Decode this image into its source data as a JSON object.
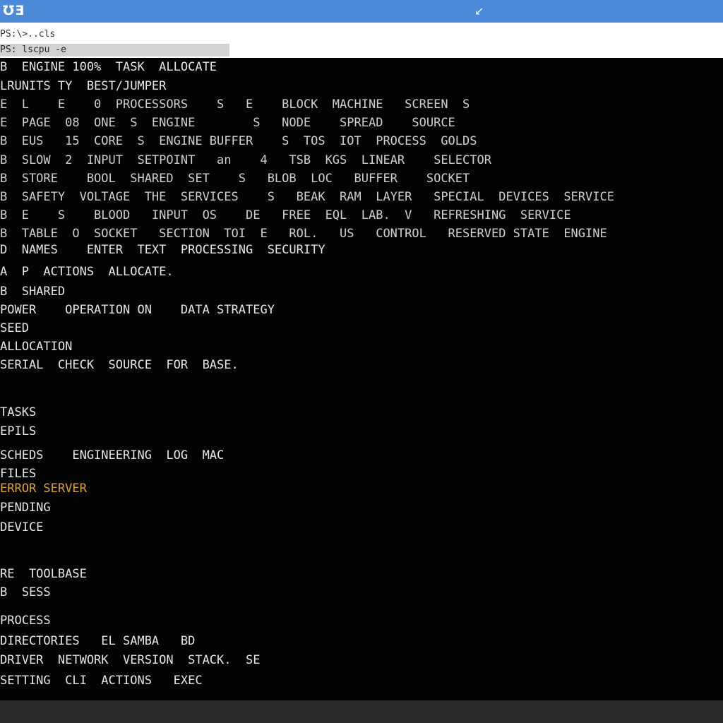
{
  "titlebar": {
    "app_icon": "ƱƎ",
    "control_glyph": "↙"
  },
  "toolbar": {
    "line1": "PS:\\>..cls",
    "line2": "PS: lscpu -e"
  },
  "colors": {
    "titlebar_bg": "#4a8ad8",
    "console_bg": "#030303",
    "text_primary": "#e6e6e6",
    "text_dim": "#b9b9b9",
    "accent_green": "#7fbf3f",
    "accent_orange": "#e0a030"
  },
  "console_lines": [
    {
      "text": "B  ENGINE 100%  TASK  ALLOCATE",
      "color": "#e6e6e6"
    },
    {
      "text": "LRUNITS TY  BEST/JUMPER",
      "color": "#e6e6e6"
    },
    {
      "text": "E  L    E    0  PROCESSORS    S   E    BLOCK  MACHINE   SCREEN  S",
      "color": "#cfcfcf"
    },
    {
      "text": "E  PAGE  08  ONE  S  ENGINE        S   NODE    SPREAD    SOURCE",
      "color": "#cfcfcf"
    },
    {
      "text": "B  EUS   15  CORE  S  ENGINE BUFFER    S  TOS  IOT  PROCESS  GOLDS",
      "color": "#cfcfcf"
    },
    {
      "text": "B  SLOW  2  INPUT  SETPOINT   an    4   TSB  KGS  LINEAR    SELECTOR",
      "color": "#cfcfcf"
    },
    {
      "text": "B  STORE    BOOL  SHARED  SET    S   BLOB  LOC   BUFFER    SOCKET",
      "color": "#cfcfcf"
    },
    {
      "text": "B  SAFETY  VOLTAGE  THE  SERVICES    S   BEAK  RAM  LAYER   SPECIAL  DEVICES  SERVICE",
      "color": "#cfcfcf"
    },
    {
      "text": "B  E    S    BLOOD   INPUT  OS    DE   FREE  EQL  LAB.  V   REFRESHING  SERVICE",
      "color": "#cfcfcf"
    },
    {
      "text": "B  TABLE  O  SOCKET   SECTION  TOI  E   ROL.   US   CONTROL   RESERVED STATE  ENGINE",
      "color": "#cfcfcf"
    },
    {
      "text": "D  NAMES    ENTER  TEXT  PROCESSING  SECURITY",
      "color": "#e6e6e6"
    },
    {
      "text": "A  P  ACTIONS  ALLOCATE.",
      "color": "#e6e6e6"
    },
    {
      "text": "B  SHARED",
      "color": "#e6e6e6"
    },
    {
      "text": "POWER    OPERATION ON    DATA STRATEGY",
      "color": "#e6e6e6"
    },
    {
      "text": "SEED",
      "color": "#e6e6e6"
    },
    {
      "text": "ALLOCATION",
      "color": "#e6e6e6"
    },
    {
      "text": "SERIAL  CHECK  SOURCE  FOR  BASE.",
      "color": "#e6e6e6"
    },
    {
      "text": "",
      "color": "#e6e6e6"
    },
    {
      "text": "TASKS",
      "color": "#e6e6e6"
    },
    {
      "text": "EPILS",
      "color": "#e6e6e6"
    },
    {
      "text": "SCHEDS    ENGINEERING  LOG  MAC",
      "color": "#e6e6e6"
    },
    {
      "text": "FILES",
      "color": "#e6e6e6"
    },
    {
      "text": "ERROR SERVER",
      "color": "#e0a030"
    },
    {
      "text": "PENDING",
      "color": "#e6e6e6"
    },
    {
      "text": "DEVICE",
      "color": "#e6e6e6"
    },
    {
      "text": "",
      "color": "#e6e6e6"
    },
    {
      "text": "RE  TOOLBASE",
      "color": "#e6e6e6"
    },
    {
      "text": "B  SESS",
      "color": "#e6e6e6"
    },
    {
      "text": "PROCESS",
      "color": "#e6e6e6"
    },
    {
      "text": "DIRECTORIES   EL SAMBA   BD",
      "color": "#e6e6e6"
    },
    {
      "text": "DRIVER  NETWORK  VERSION  STACK.  SE",
      "color": "#e6e6e6"
    },
    {
      "text": "SETTING  CLI  ACTIONS   EXEC",
      "color": "#e6e6e6"
    }
  ]
}
